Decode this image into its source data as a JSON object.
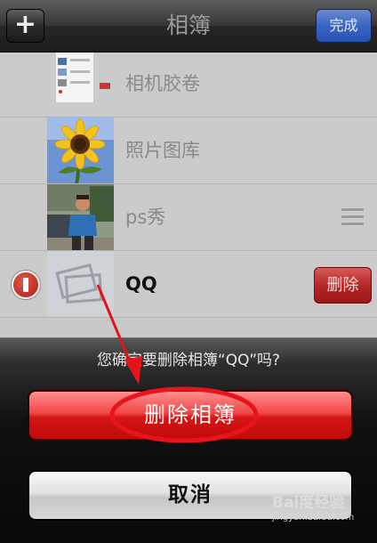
{
  "nav": {
    "title": "相簿",
    "add_label": "+",
    "done_label": "完成"
  },
  "albums": [
    {
      "name": "相机胶卷",
      "style": "normal"
    },
    {
      "name": "照片图库",
      "style": "normal"
    },
    {
      "name": "ps秀",
      "style": "normal"
    },
    {
      "name": "QQ",
      "style": "bold",
      "delete_label": "删除"
    }
  ],
  "dialog": {
    "question": "您确定要删除相簿“QQ”吗?",
    "delete_label": "删除相簿",
    "cancel_label": "取消"
  },
  "watermark": {
    "logo": "Bai度经验",
    "url": "jingyan.baidu.com"
  },
  "colors": {
    "destructive": "#d41515",
    "annotation": "#e8141b",
    "done_button": "#3a64c4"
  }
}
